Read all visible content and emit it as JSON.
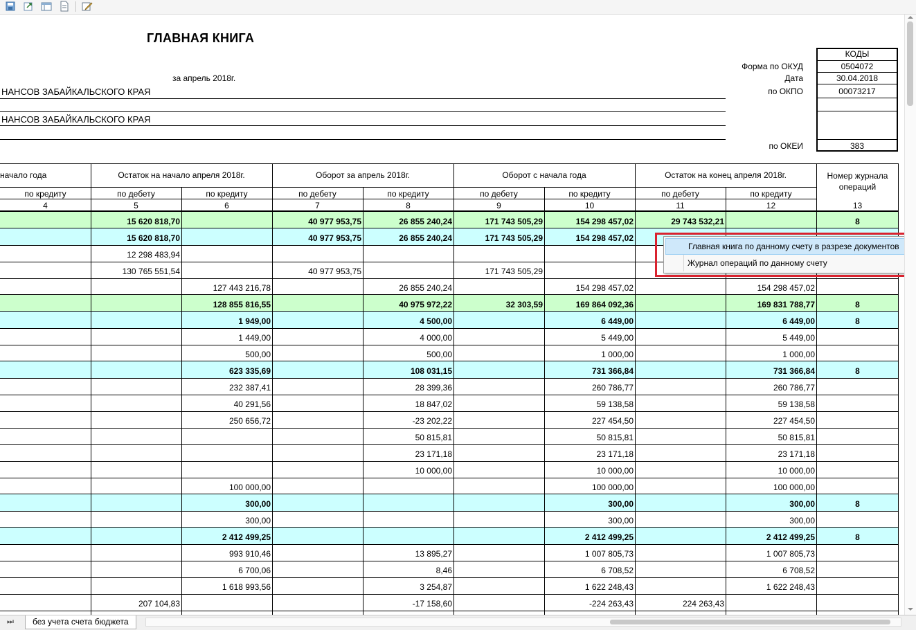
{
  "toolbar": {
    "icons": [
      "save-icon",
      "export-icon",
      "window-icon",
      "document-icon",
      "edit-icon"
    ]
  },
  "report": {
    "title": "ГЛАВНАЯ КНИГА",
    "period": "за апрель 2018г.",
    "org_line_1": "НАНСОВ ЗАБАЙКАЛЬСКОГО КРАЯ",
    "org_line_2": "НАНСОВ ЗАБАЙКАЛЬСКОГО КРАЯ"
  },
  "codes": {
    "header": "КОДЫ",
    "okud_label": "Форма по ОКУД",
    "okud_value": "0504072",
    "date_label": "Дата",
    "date_value": "30.04.2018",
    "okpo_label": "по ОКПО",
    "okpo_value": "00073217",
    "okei_label": "по ОКЕИ",
    "okei_value": "383"
  },
  "table": {
    "group_headers": [
      "начало года",
      "Остаток на начало апреля 2018г.",
      "Оборот за апрель 2018г.",
      "Оборот с начала года",
      "Остаток на конец апреля 2018г.",
      "Номер журнала операций"
    ],
    "sub_headers": [
      "по кредиту",
      "по дебету",
      "по кредиту",
      "по дебету",
      "по кредиту",
      "по дебету",
      "по кредиту",
      "по дебету",
      "по кредиту"
    ],
    "column_numbers": [
      "4",
      "5",
      "6",
      "7",
      "8",
      "9",
      "10",
      "11",
      "12",
      "13"
    ],
    "rows": [
      {
        "style": "green",
        "bold": true,
        "cells": [
          "",
          "15 620 818,70",
          "",
          "40 977 953,75",
          "26 855 240,24",
          "171 743 505,29",
          "154 298 457,02",
          "29 743 532,21",
          "",
          "8"
        ]
      },
      {
        "style": "cyan",
        "bold": true,
        "cells": [
          "",
          "15 620 818,70",
          "",
          "40 977 953,75",
          "26 855 240,24",
          "171 743 505,29",
          "154 298 457,02",
          "",
          "",
          ""
        ]
      },
      {
        "style": "",
        "bold": false,
        "cells": [
          "",
          "12 298 483,94",
          "",
          "",
          "",
          "",
          "",
          "",
          "",
          ""
        ]
      },
      {
        "style": "",
        "bold": false,
        "cells": [
          "",
          "130 765 551,54",
          "",
          "40 977 953,75",
          "",
          "171 743 505,29",
          "",
          "",
          "",
          ""
        ]
      },
      {
        "style": "",
        "bold": false,
        "cells": [
          "",
          "",
          "127 443 216,78",
          "",
          "26 855 240,24",
          "",
          "154 298 457,02",
          "",
          "154 298 457,02",
          ""
        ]
      },
      {
        "style": "green",
        "bold": true,
        "cells": [
          "",
          "",
          "128 855 816,55",
          "",
          "40 975 972,22",
          "32 303,59",
          "169 864 092,36",
          "",
          "169 831 788,77",
          "8"
        ]
      },
      {
        "style": "cyan",
        "bold": true,
        "cells": [
          "",
          "",
          "1 949,00",
          "",
          "4 500,00",
          "",
          "6 449,00",
          "",
          "6 449,00",
          "8"
        ]
      },
      {
        "style": "",
        "bold": false,
        "cells": [
          "",
          "",
          "1 449,00",
          "",
          "4 000,00",
          "",
          "5 449,00",
          "",
          "5 449,00",
          ""
        ]
      },
      {
        "style": "",
        "bold": false,
        "cells": [
          "",
          "",
          "500,00",
          "",
          "500,00",
          "",
          "1 000,00",
          "",
          "1 000,00",
          ""
        ]
      },
      {
        "style": "cyan",
        "bold": true,
        "cells": [
          "",
          "",
          "623 335,69",
          "",
          "108 031,15",
          "",
          "731 366,84",
          "",
          "731 366,84",
          "8"
        ]
      },
      {
        "style": "",
        "bold": false,
        "cells": [
          "",
          "",
          "232 387,41",
          "",
          "28 399,36",
          "",
          "260 786,77",
          "",
          "260 786,77",
          ""
        ]
      },
      {
        "style": "",
        "bold": false,
        "cells": [
          "",
          "",
          "40 291,56",
          "",
          "18 847,02",
          "",
          "59 138,58",
          "",
          "59 138,58",
          ""
        ]
      },
      {
        "style": "",
        "bold": false,
        "cells": [
          "",
          "",
          "250 656,72",
          "",
          "-23 202,22",
          "",
          "227 454,50",
          "",
          "227 454,50",
          ""
        ]
      },
      {
        "style": "",
        "bold": false,
        "cells": [
          "",
          "",
          "",
          "",
          "50 815,81",
          "",
          "50 815,81",
          "",
          "50 815,81",
          ""
        ]
      },
      {
        "style": "",
        "bold": false,
        "cells": [
          "",
          "",
          "",
          "",
          "23 171,18",
          "",
          "23 171,18",
          "",
          "23 171,18",
          ""
        ]
      },
      {
        "style": "",
        "bold": false,
        "cells": [
          "",
          "",
          "",
          "",
          "10 000,00",
          "",
          "10 000,00",
          "",
          "10 000,00",
          ""
        ]
      },
      {
        "style": "",
        "bold": false,
        "cells": [
          "",
          "",
          "100 000,00",
          "",
          "",
          "",
          "100 000,00",
          "",
          "100 000,00",
          ""
        ]
      },
      {
        "style": "cyan",
        "bold": true,
        "cells": [
          "",
          "",
          "300,00",
          "",
          "",
          "",
          "300,00",
          "",
          "300,00",
          "8"
        ]
      },
      {
        "style": "",
        "bold": false,
        "cells": [
          "",
          "",
          "300,00",
          "",
          "",
          "",
          "300,00",
          "",
          "300,00",
          ""
        ]
      },
      {
        "style": "cyan",
        "bold": true,
        "cells": [
          "",
          "",
          "2 412 499,25",
          "",
          "",
          "",
          "2 412 499,25",
          "",
          "2 412 499,25",
          "8"
        ]
      },
      {
        "style": "",
        "bold": false,
        "cells": [
          "",
          "",
          "993 910,46",
          "",
          "13 895,27",
          "",
          "1 007 805,73",
          "",
          "1 007 805,73",
          ""
        ]
      },
      {
        "style": "",
        "bold": false,
        "cells": [
          "",
          "",
          "6 700,06",
          "",
          "8,46",
          "",
          "6 708,52",
          "",
          "6 708,52",
          ""
        ]
      },
      {
        "style": "",
        "bold": false,
        "cells": [
          "",
          "",
          "1 618 993,56",
          "",
          "3 254,87",
          "",
          "1 622 248,43",
          "",
          "1 622 248,43",
          ""
        ]
      },
      {
        "style": "",
        "bold": false,
        "cells": [
          "",
          "207 104,83",
          "",
          "",
          "-17 158,60",
          "",
          "-224 263,43",
          "224 263,43",
          "",
          ""
        ]
      }
    ]
  },
  "context_menu": {
    "items": [
      "Главная книга по данному счету в разрезе документов",
      "Журнал операций по данному счету"
    ]
  },
  "sheet_tab": {
    "label": "без учета счета бюджета"
  },
  "colors": {
    "row_green": "#ccffcc",
    "row_cyan": "#ccffff",
    "highlight_red": "#d9232f",
    "menu_hover": "#cfe8fa"
  }
}
